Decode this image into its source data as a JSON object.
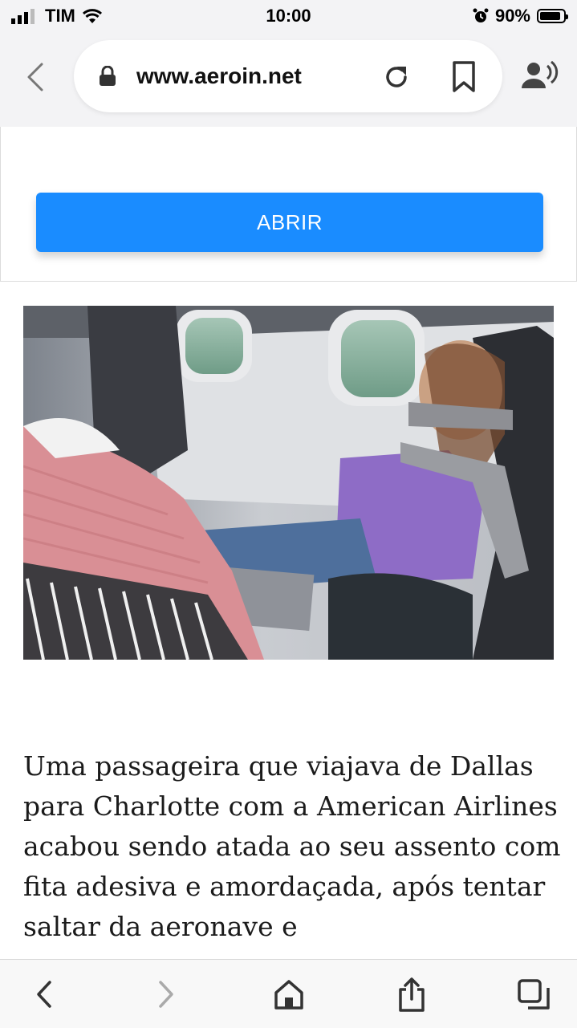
{
  "status_bar": {
    "carrier": "TIM",
    "time": "10:00",
    "battery_percent": "90%",
    "battery_level": 0.9
  },
  "browser": {
    "url": "www.aeroin.net",
    "icons": [
      "back-icon",
      "lock-icon",
      "reload-icon",
      "bookmark-icon",
      "read-aloud-icon"
    ]
  },
  "ad": {
    "button_label": "ABRIR",
    "button_color": "#1a8cff"
  },
  "article": {
    "text": "Uma passageira que viajava de Dallas para Charlotte com a American Airlines acabou sendo atada ao seu assento com fita adesiva e amordaçada, após tentar saltar da aeronave e"
  },
  "toolbar": {
    "icons": [
      "back-arrow-icon",
      "forward-arrow-icon",
      "home-icon",
      "share-icon",
      "tabs-icon"
    ]
  }
}
